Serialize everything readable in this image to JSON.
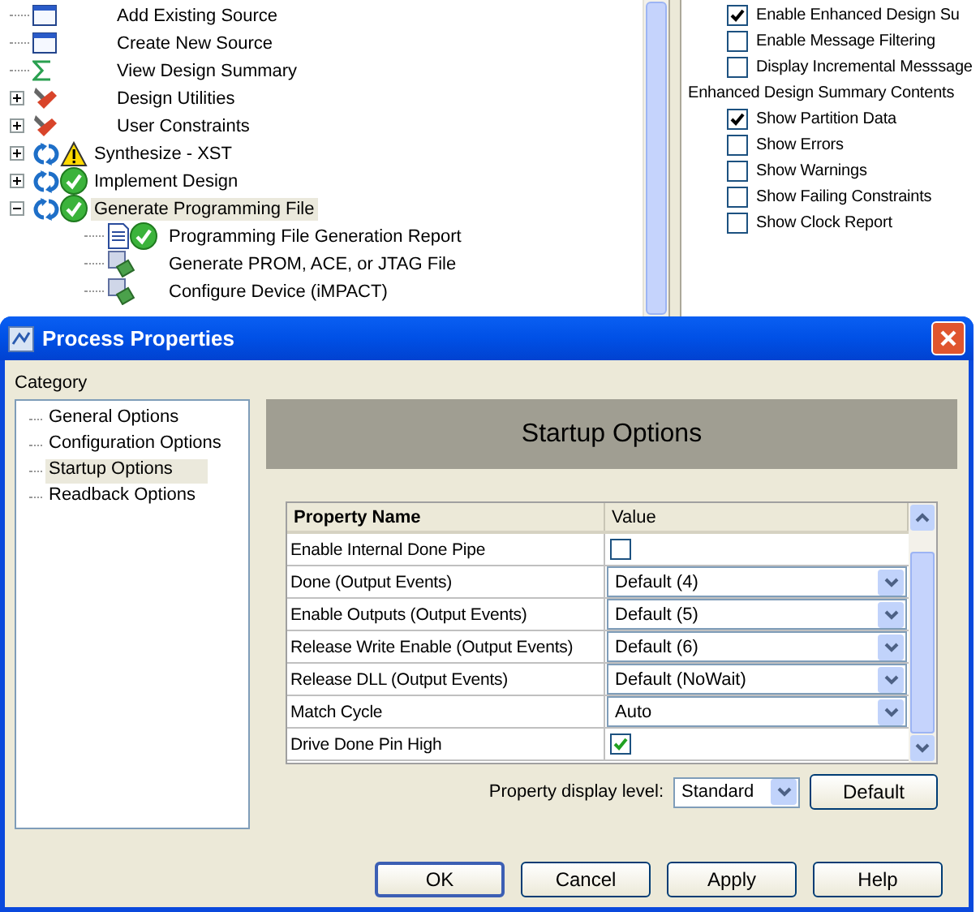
{
  "process_tree": {
    "items": [
      {
        "label": "Add Existing Source",
        "kind": "source",
        "selected": false
      },
      {
        "label": "Create New Source",
        "kind": "source",
        "selected": false
      },
      {
        "label": "View Design Summary",
        "kind": "summary",
        "selected": false
      },
      {
        "label": "Design Utilities",
        "kind": "tools",
        "expanded": false,
        "selected": false
      },
      {
        "label": "User Constraints",
        "kind": "tools",
        "expanded": false,
        "selected": false
      },
      {
        "label": "Synthesize - XST",
        "kind": "warning",
        "expanded": false,
        "selected": false
      },
      {
        "label": "Implement Design",
        "kind": "done",
        "expanded": false,
        "selected": false
      },
      {
        "label": "Generate Programming File",
        "kind": "done",
        "expanded": true,
        "selected": true,
        "children": [
          {
            "label": "Programming File Generation Report",
            "kind": "report",
            "selected": false
          },
          {
            "label": "Generate PROM, ACE, or JTAG File",
            "kind": "device",
            "selected": false
          },
          {
            "label": "Configure Device (iMPACT)",
            "kind": "device",
            "selected": false
          }
        ]
      }
    ]
  },
  "summary_options": {
    "options": [
      {
        "label": "Enable Enhanced Design Su",
        "checked": true
      },
      {
        "label": "Enable Message Filtering",
        "checked": false
      },
      {
        "label": "Display Incremental Messsage",
        "checked": false
      }
    ],
    "section_title": "Enhanced Design Summary Contents",
    "contents": [
      {
        "label": "Show Partition Data",
        "checked": true
      },
      {
        "label": "Show Errors",
        "checked": false
      },
      {
        "label": "Show Warnings",
        "checked": false
      },
      {
        "label": "Show Failing Constraints",
        "checked": false
      },
      {
        "label": "Show Clock Report",
        "checked": false
      }
    ]
  },
  "dialog": {
    "title": "Process Properties",
    "category_label": "Category",
    "categories": [
      {
        "label": "General Options",
        "selected": false
      },
      {
        "label": "Configuration Options",
        "selected": false
      },
      {
        "label": "Startup Options",
        "selected": true
      },
      {
        "label": "Readback Options",
        "selected": false
      }
    ],
    "header": "Startup Options",
    "table": {
      "columns": [
        "Property Name",
        "Value"
      ],
      "rows": [
        {
          "name": "Enable Internal Done Pipe",
          "kind": "checkbox",
          "checked": false
        },
        {
          "name": "Done (Output Events)",
          "kind": "select",
          "value": "Default (4)"
        },
        {
          "name": "Enable Outputs (Output Events)",
          "kind": "select",
          "value": "Default (5)"
        },
        {
          "name": "Release Write Enable (Output Events)",
          "kind": "select",
          "value": "Default (6)"
        },
        {
          "name": "Release DLL (Output Events)",
          "kind": "select",
          "value": "Default (NoWait)"
        },
        {
          "name": "Match Cycle",
          "kind": "select",
          "value": "Auto"
        },
        {
          "name": "Drive Done Pin High",
          "kind": "checkbox",
          "checked": true
        }
      ]
    },
    "display_level": {
      "label": "Property display level:",
      "value": "Standard"
    },
    "default_button": "Default",
    "buttons": [
      {
        "label": "OK",
        "default": true
      },
      {
        "label": "Cancel",
        "default": false
      },
      {
        "label": "Apply",
        "default": false
      },
      {
        "label": "Help",
        "default": false
      }
    ]
  }
}
